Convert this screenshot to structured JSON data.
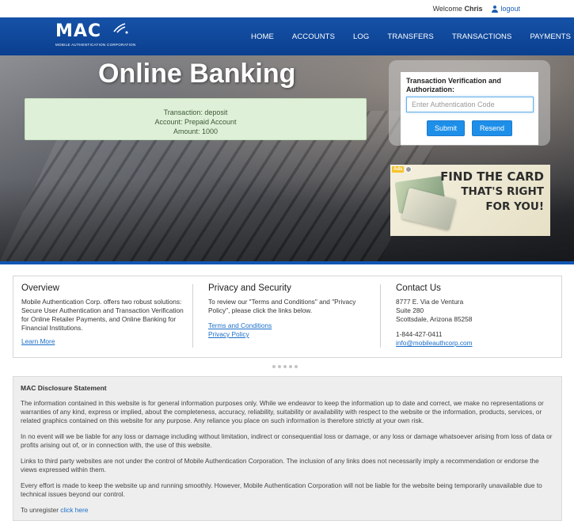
{
  "topbar": {
    "welcome_prefix": "Welcome",
    "username": "Chris",
    "logout_label": "logout"
  },
  "logo": {
    "text": "MAC",
    "tagline": "MOBILE AUTHENTICATION CORPORATION"
  },
  "nav": {
    "items": [
      {
        "label": "HOME"
      },
      {
        "label": "ACCOUNTS"
      },
      {
        "label": "LOG"
      },
      {
        "label": "TRANSFERS"
      },
      {
        "label": "TRANSACTIONS"
      },
      {
        "label": "PAYMENTS"
      }
    ]
  },
  "hero": {
    "title": "Online Banking",
    "transaction": {
      "line1": "Transaction: deposit",
      "line2": "Account: Prepaid Account",
      "line3": "Amount: 1000"
    }
  },
  "auth": {
    "label": "Transaction Verification and Authorization:",
    "placeholder": "Enter Authentication Code",
    "submit_label": "Submit",
    "resend_label": "Resend"
  },
  "ad": {
    "badge": "Ads",
    "line1": "FIND THE CARD",
    "line2": "THAT'S RIGHT",
    "line3": "FOR YOU!"
  },
  "overview": {
    "heading": "Overview",
    "body": "Mobile Authentication Corp. offers two robust solutions: Secure User Authentication and Transaction Verification for Online Retailer Payments, and Online Banking for Financial Institutions.",
    "link": "Learn More"
  },
  "privacy": {
    "heading": "Privacy and Security",
    "body": "To review our \"Terms and Conditions\" and \"Privacy Policy\", please click the links below.",
    "terms_link": "Terms and Conditions",
    "privacy_link": "Privacy Policy"
  },
  "contact": {
    "heading": "Contact Us",
    "address1": "8777 E. Via de Ventura",
    "address2": "Suite 280",
    "address3": "Scottsdale, Arizona 85258",
    "phone": "1-844-427-0411",
    "email": "info@mobileauthcorp.com"
  },
  "disclosure": {
    "heading": "MAC Disclosure Statement",
    "p1": "The information contained in this website is for general information purposes only. While we endeavor to keep the information up to date and correct, we make no representations or warranties of any kind, express or implied, about the completeness, accuracy, reliability, suitability or availability with respect to the website or the information, products, services, or related graphics contained on this website for any purpose. Any reliance you place on such information is therefore strictly at your own risk.",
    "p2": "In no event will we be liable for any loss or damage including without limitation, indirect or consequential loss or damage, or any loss or damage whatsoever arising from loss of data or profits arising out of, or in connection with, the use of this website.",
    "p3": "Links to third party websites are not under the control of Mobile Authentication Corporation. The inclusion of any links does not necessarily imply a recommendation or endorse the views expressed within them.",
    "p4": "Every effort is made to keep the website up and running smoothly. However, Mobile Authentication Corporation will not be liable for the website being temporarily unavailable due to technical issues beyond our control.",
    "unregister_prefix": "To unregister",
    "unregister_link": "click here"
  },
  "colors": {
    "nav_blue": "#0b3f8f",
    "button_blue": "#1e8fe8",
    "success_bg": "#dff0d8",
    "link": "#1a6ec9"
  }
}
